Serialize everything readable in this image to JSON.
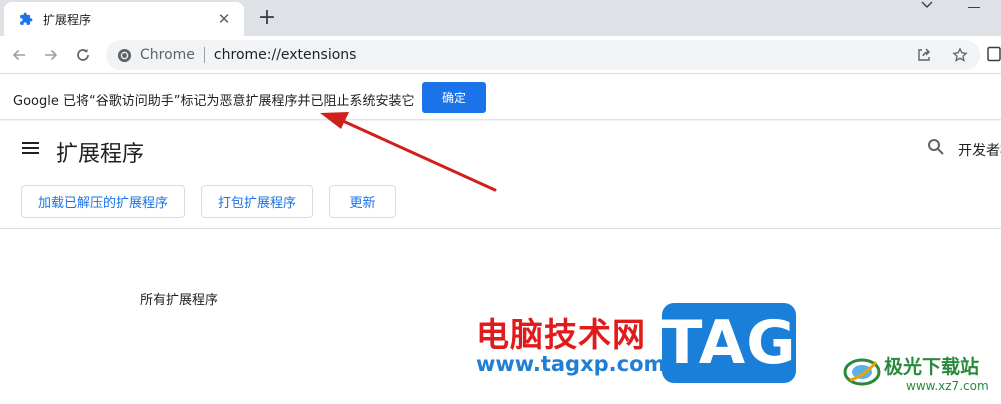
{
  "tab": {
    "title": "扩展程序",
    "icon": "puzzle-icon",
    "close": "✕",
    "new_tab": "+"
  },
  "toolbar": {
    "site_chip": "Chrome",
    "url": "chrome://extensions",
    "icons": [
      "back-arrow-icon",
      "forward-arrow-icon",
      "reload-icon",
      "share-icon",
      "star-icon",
      "side-panel-icon"
    ]
  },
  "infobar": {
    "message": "Google 已将“谷歌访问助手”标记为恶意扩展程序并已阻止系统安装它",
    "button_label": "确定"
  },
  "page": {
    "title": "扩展程序",
    "developer_mode_label": "开发者模式",
    "buttons": [
      "加载已解压的扩展程序",
      "打包扩展程序",
      "更新"
    ],
    "section_label": "所有扩展程序"
  },
  "watermark": {
    "site_name": "电脑技术网",
    "url": "www.tagxp.com",
    "badge": "TAG",
    "xz_name": "极光下载站",
    "xz_url": "www.xz7.com"
  },
  "colors": {
    "accent": "#1a73e8",
    "arrow": "#d0201b",
    "watermark_red": "#e11b1b",
    "watermark_blue": "#1a7fd8"
  }
}
